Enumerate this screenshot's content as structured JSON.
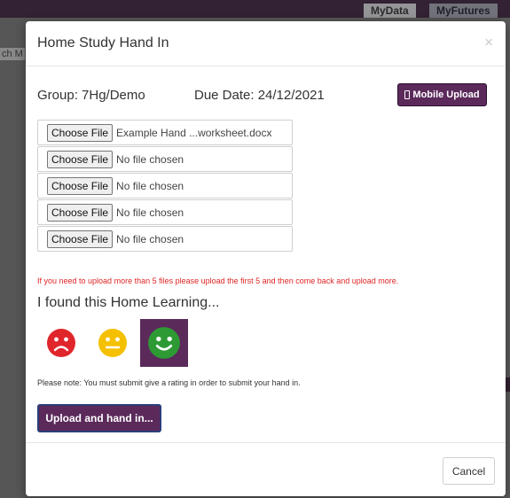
{
  "background": {
    "tabs": [
      "MyData",
      "MyFutures"
    ],
    "left_snippet": "ch M"
  },
  "modal": {
    "title": "Home Study Hand In",
    "close_glyph": "×",
    "group": "Group: 7Hg/Demo",
    "due_date": "Due Date: 24/12/2021",
    "mobile_upload_label": "Mobile Upload",
    "files": [
      {
        "button": "Choose File",
        "name": "Example Hand ...worksheet.docx"
      },
      {
        "button": "Choose File",
        "name": "No file chosen"
      },
      {
        "button": "Choose File",
        "name": "No file chosen"
      },
      {
        "button": "Choose File",
        "name": "No file chosen"
      },
      {
        "button": "Choose File",
        "name": "No file chosen"
      }
    ],
    "warning": "If you need to upload more than 5 files please upload the first 5 and then come back and upload more.",
    "rating_title": "I found this Home Learning...",
    "ratings": [
      {
        "icon": "sad-face-icon",
        "color": "#e0262b",
        "selected": false
      },
      {
        "icon": "neutral-face-icon",
        "color": "#f5c000",
        "selected": false
      },
      {
        "icon": "happy-face-icon",
        "color": "#2d9a34",
        "selected": true
      }
    ],
    "note": "Please note: You must submit give a rating in order to submit your hand in.",
    "submit_label": "Upload and hand in...",
    "cancel_label": "Cancel"
  },
  "colors": {
    "accent": "#5b2a5b",
    "warning": "#e02424"
  }
}
